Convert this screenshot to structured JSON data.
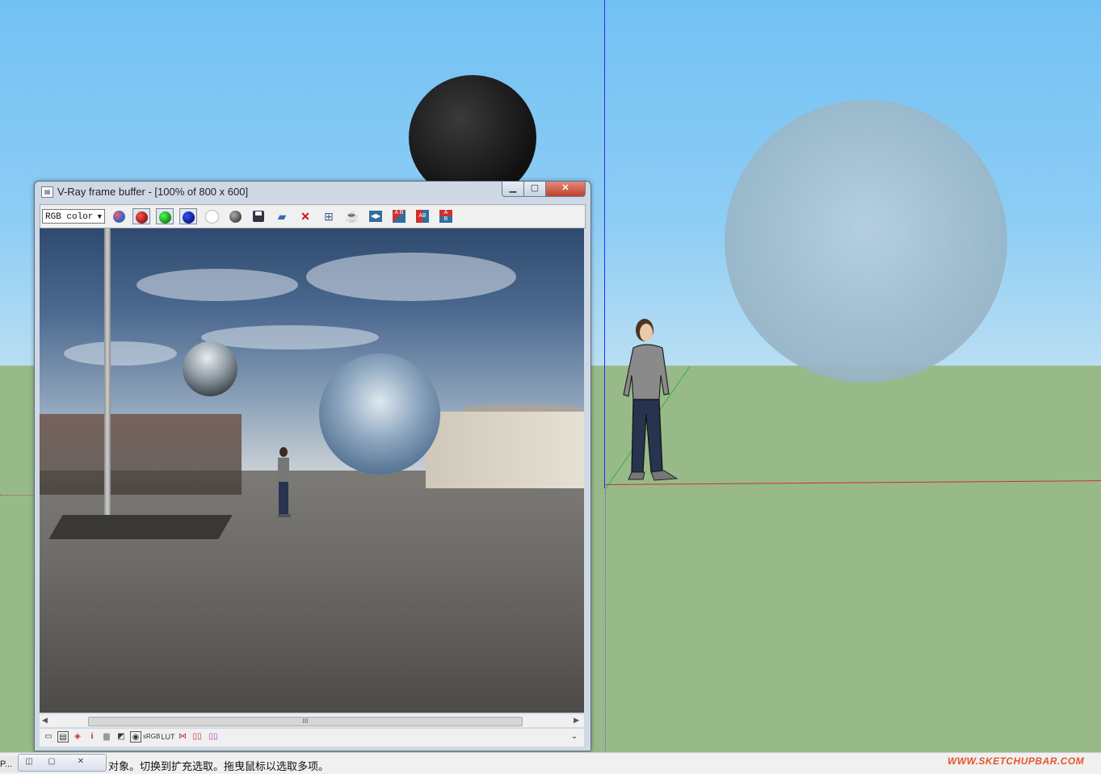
{
  "vfb": {
    "title": "V-Ray frame buffer - [100% of 800 x 600]",
    "window_controls": {
      "minimize": "▁",
      "maximize": "▢",
      "close": "✕"
    },
    "channel": "RGB color",
    "toolbar_icons": [
      "rgb-channels-icon",
      "red-channel-icon",
      "green-channel-icon",
      "blue-channel-icon",
      "alpha-channel-icon",
      "mono-icon",
      "save-icon",
      "open-icon",
      "clear-icon",
      "region-icon",
      "render-teapot-icon",
      "track-mouse-icon",
      "ab-compare-icon-1",
      "ab-compare-icon-2",
      "ab-compare-icon-3"
    ],
    "scroll_thumb": "III",
    "bottom_icons": [
      "pixel-info-icon",
      "history-icon",
      "color-correction-icon",
      "info-icon",
      "levels-icon",
      "curves-icon",
      "exposure-icon",
      "srgb-icon",
      "lut-icon",
      "ocio-icon",
      "compare-icon",
      "stamp-icon",
      "expand-icon"
    ],
    "bottom_labels": {
      "info": "i",
      "srgb": "sRGB",
      "lut": "LUT"
    }
  },
  "statusbar": {
    "task_label": "P...",
    "text": "对象。切换到扩充选取。拖曳鼠标以选取多项。",
    "watermark": "WWW.SKETCHUPBAR.COM"
  },
  "colors": {
    "sky": "#7fc6f5",
    "ground": "#98ba88",
    "blue_axis": "#2a2aff",
    "red_axis": "#d03030",
    "green_axis": "#3ab03a"
  }
}
